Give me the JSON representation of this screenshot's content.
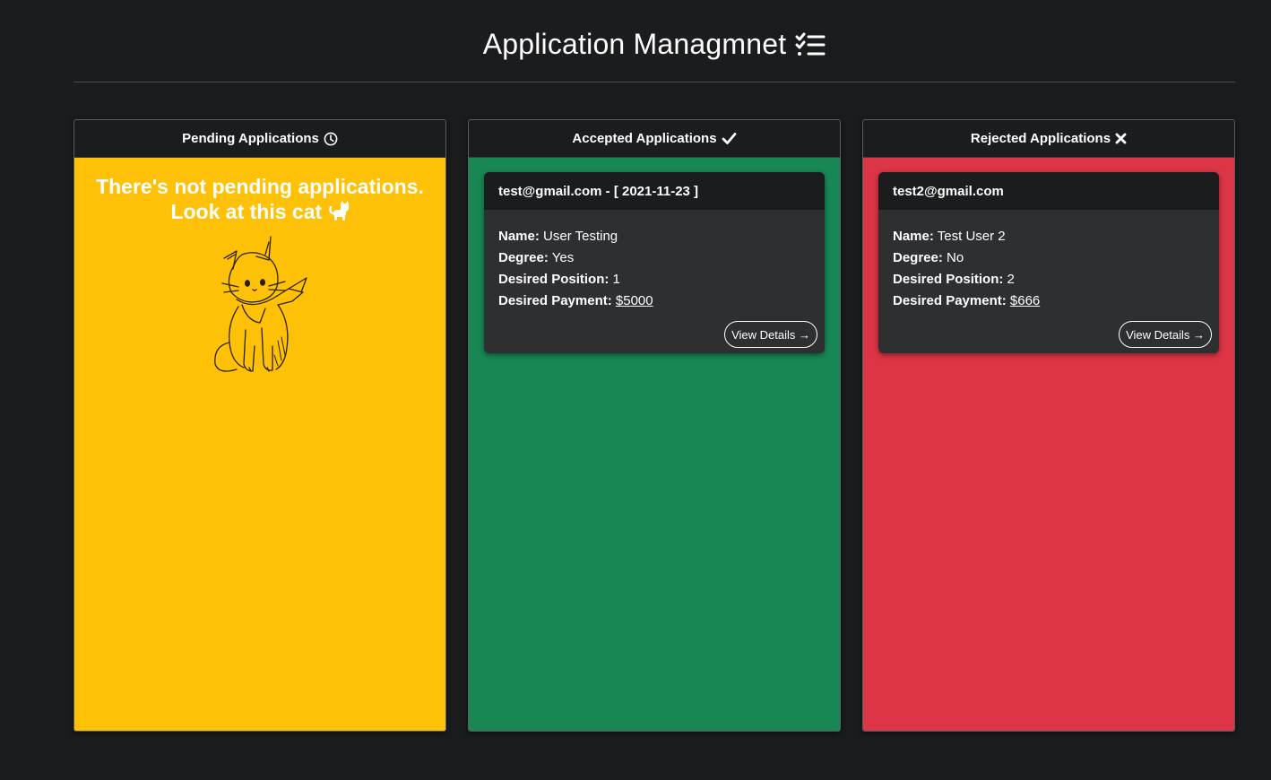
{
  "header": {
    "title": "Application Managmnet",
    "title_icon": "checklist-icon"
  },
  "colors": {
    "background": "#1b1c1e",
    "pending": "#ffc107",
    "accepted": "#198754",
    "rejected": "#dc3545",
    "card": "#2e2f31"
  },
  "columns": {
    "pending": {
      "title": "Pending Applications",
      "icon": "clock-icon",
      "empty_line1": "There's not pending applications.",
      "empty_line2": "Look at this cat",
      "empty_icon": "cat-emoji-icon",
      "image": "cat-illustration"
    },
    "accepted": {
      "title": "Accepted Applications",
      "icon": "checkmark-icon",
      "cards": [
        {
          "header": "test@gmail.com - [ 2021-11-23 ]",
          "name_label": "Name:",
          "name": "User Testing",
          "degree_label": "Degree:",
          "degree": "Yes",
          "position_label": "Desired Position:",
          "position": "1",
          "payment_label": "Desired Payment:",
          "payment": "$5000",
          "button": "View Details →"
        }
      ]
    },
    "rejected": {
      "title": "Rejected Applications",
      "icon": "x-icon",
      "cards": [
        {
          "header": "test2@gmail.com",
          "name_label": "Name:",
          "name": "Test User 2",
          "degree_label": "Degree:",
          "degree": "No",
          "position_label": "Desired Position:",
          "position": "2",
          "payment_label": "Desired Payment:",
          "payment": "$666",
          "button": "View Details →"
        }
      ]
    }
  }
}
